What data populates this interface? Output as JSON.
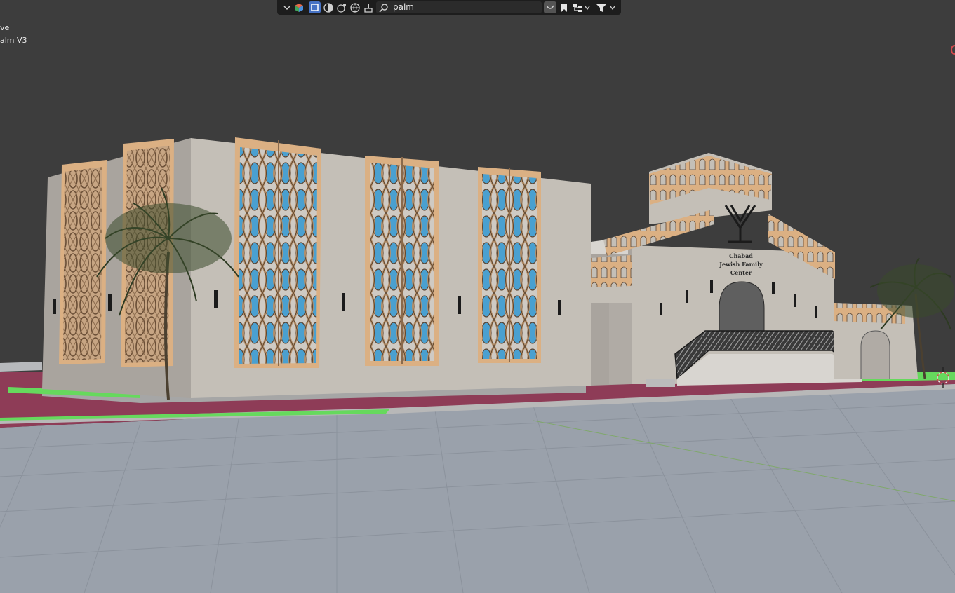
{
  "header": {
    "search_value": "palm",
    "search_placeholder": "Search",
    "icons": [
      "chevron-down-icon",
      "display-mode-icon",
      "selectable-icon",
      "viewport-shading-icon",
      "render-icon",
      "scene-icon",
      "brush-icon",
      "search-icon",
      "match-case-icon",
      "bookmark-icon",
      "hierarchy-icon",
      "filter-icon"
    ]
  },
  "viewport_overlay": {
    "mode_text": "ve",
    "object_name": "alm V3"
  },
  "sign": {
    "line1": "Chabad",
    "line2": "Jewish Family",
    "line3": "Center"
  },
  "colors": {
    "viewport_bg": "#3d3d3d",
    "ground": "#9aa1ab",
    "wall": "#c4bfb7",
    "trim": "#dbb083",
    "glass": "#4aa0d0",
    "path_red": "#8e3c57",
    "grass": "#66d95d",
    "header_bg": "#1d1d1d",
    "active_icon": "#4672c4",
    "gizmo_red": "#d4494c"
  }
}
